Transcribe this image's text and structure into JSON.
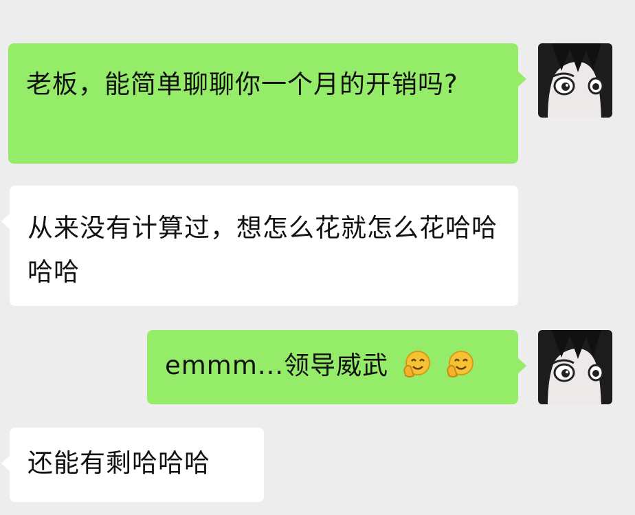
{
  "messages": [
    {
      "direction": "sent",
      "text": "老板，能简单聊聊你一个月的开销吗?"
    },
    {
      "direction": "received",
      "text": "从来没有计算过，想怎么花就怎么花哈哈哈哈"
    },
    {
      "direction": "sent",
      "text": "emmm...领导威武",
      "emojis": [
        "clapping-smile-emoji",
        "clapping-smile-emoji"
      ]
    },
    {
      "direction": "received",
      "text": "还能有剩哈哈哈"
    }
  ],
  "colors": {
    "background": "#ededed",
    "sent_bubble": "#95ec69",
    "received_bubble": "#ffffff",
    "text": "#111111"
  }
}
